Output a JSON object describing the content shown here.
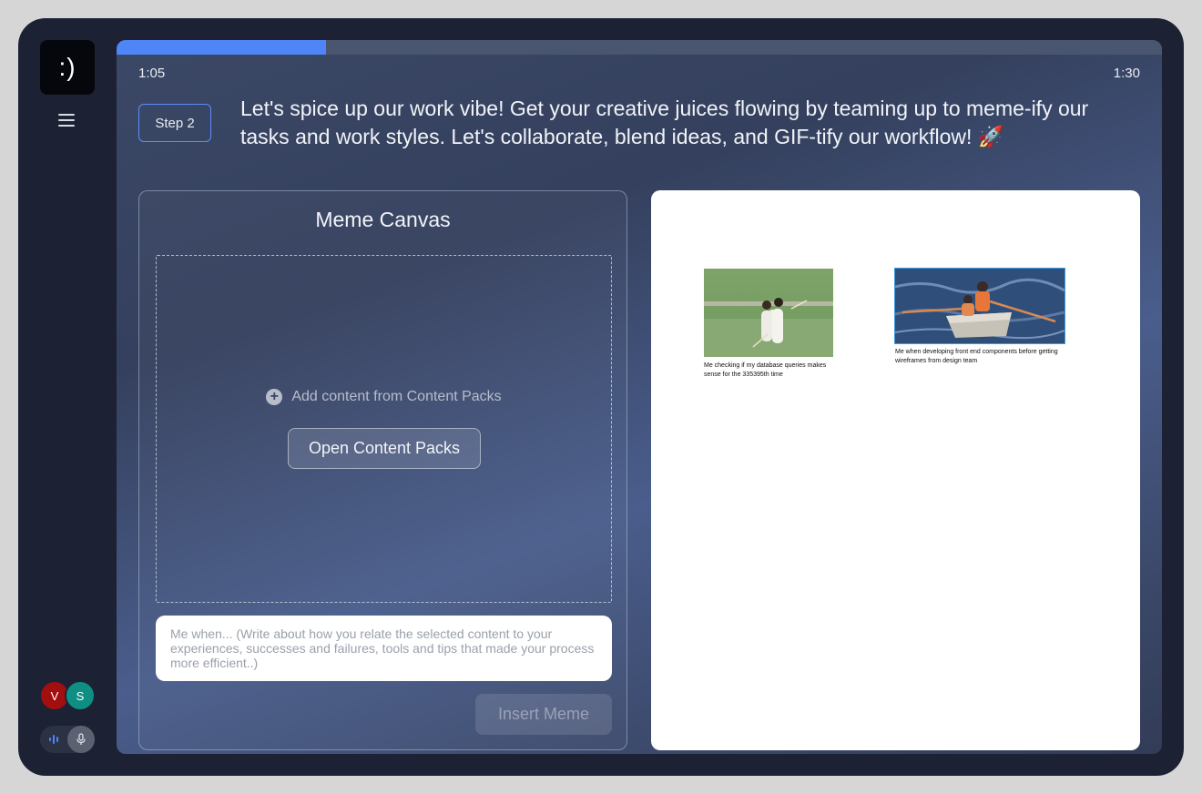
{
  "sidebar": {
    "logo_text": ":)",
    "participants": [
      {
        "initial": "V",
        "color": "#a30f0f"
      },
      {
        "initial": "S",
        "color": "#0f8e83"
      }
    ]
  },
  "session": {
    "progress_fraction": 0.2,
    "elapsed": "1:05",
    "total": "1:30",
    "accent_color": "#4f86f7"
  },
  "step": {
    "label": "Step 2",
    "prompt": "Let's spice up our work vibe! Get your creative juices flowing by teaming up to meme-ify our tasks and work styles. Let's collaborate, blend ideas, and GIF-tify our workflow! 🚀"
  },
  "canvas": {
    "title": "Meme Canvas",
    "add_content_label": "Add content from Content Packs",
    "open_packs_label": "Open Content Packs",
    "caption_placeholder": "Me when... (Write about how you relate the selected content to your experiences, successes and failures, tools and tips that made your process more efficient..)",
    "insert_label": "Insert Meme"
  },
  "board": {
    "memes": [
      {
        "caption": "Me checking if my database queries makes sense for the 335395th time",
        "image": "cricket-players-photo"
      },
      {
        "caption": "Me when developing front end components before getting wireframes from design team",
        "image": "rowboat-photo"
      }
    ]
  }
}
